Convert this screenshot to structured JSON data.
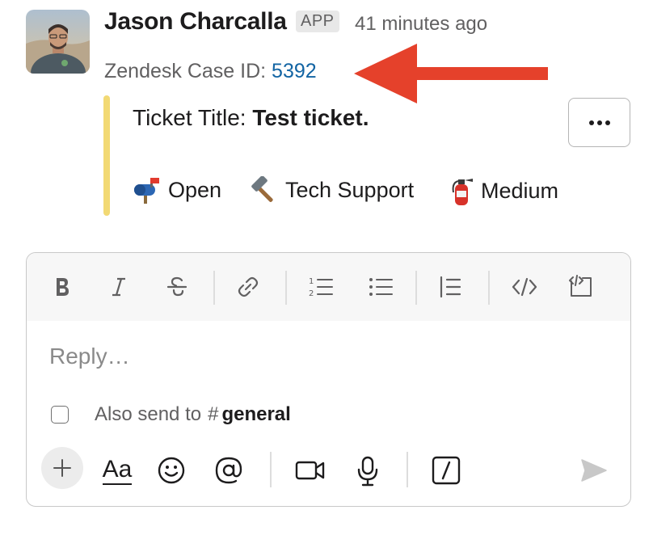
{
  "message": {
    "author": "Jason Charcalla",
    "badge": "APP",
    "timestamp": "41 minutes ago",
    "case_label": "Zendesk Case ID:",
    "case_id": "5392"
  },
  "attachment": {
    "title_label": "Ticket Title:",
    "title_value": "Test ticket.",
    "accent_color": "#f2d974",
    "fields": [
      {
        "icon": "mailbox-icon",
        "label": "Open"
      },
      {
        "icon": "hammer-icon",
        "label": "Tech Support"
      },
      {
        "icon": "fire-extinguisher-icon",
        "label": "Medium"
      }
    ]
  },
  "composer": {
    "placeholder": "Reply…",
    "also_send": "Also send to",
    "channel_hash": "#",
    "channel": "general",
    "format_label": "Aa",
    "toolbar_icons": [
      "bold-icon",
      "italic-icon",
      "strikethrough-icon",
      "link-icon",
      "ordered-list-icon",
      "bulleted-list-icon",
      "blockquote-icon",
      "code-icon",
      "code-block-icon"
    ],
    "bottom_icons": [
      "plus-icon",
      "format-icon",
      "emoji-icon",
      "mention-icon",
      "video-icon",
      "microphone-icon",
      "slash-command-icon",
      "send-icon"
    ]
  },
  "colors": {
    "link": "#1264a3",
    "arrow": "#e5412b"
  }
}
